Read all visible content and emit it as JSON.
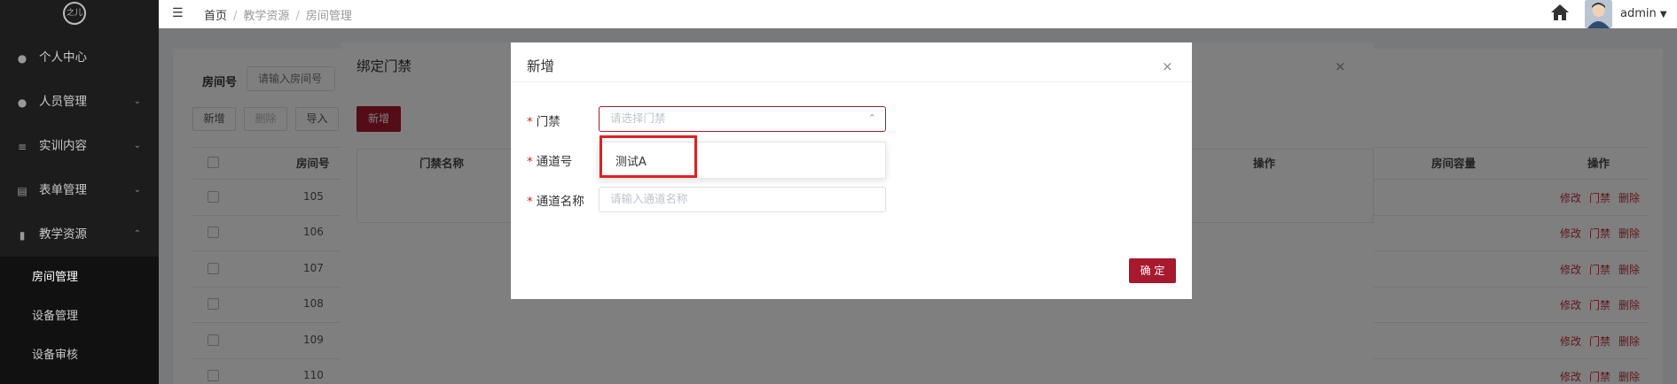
{
  "app": {
    "logo_text": "之儿"
  },
  "sidebar": {
    "items": [
      {
        "label": "个人中心",
        "icon": "user-icon"
      },
      {
        "label": "人员管理",
        "icon": "users-icon"
      },
      {
        "label": "实训内容",
        "icon": "list-icon"
      },
      {
        "label": "表单管理",
        "icon": "form-icon"
      },
      {
        "label": "教学资源",
        "icon": "book-icon"
      }
    ],
    "submenu": [
      {
        "label": "房间管理"
      },
      {
        "label": "设备管理"
      },
      {
        "label": "设备审核"
      }
    ]
  },
  "header": {
    "breadcrumb": [
      "首页",
      "教学资源",
      "房间管理"
    ],
    "username": "admin"
  },
  "page": {
    "search_label": "房间号",
    "search_placeholder": "请输入房间号",
    "buttons": {
      "add": "新增",
      "delete": "删除",
      "import": "导入"
    },
    "columns": {
      "room_no": "房间号",
      "capacity": "房间容量",
      "actions": "操作"
    },
    "rows": [
      "105",
      "106",
      "107",
      "108",
      "109",
      "110"
    ],
    "row_actions": {
      "edit": "修改",
      "access": "门禁",
      "delete": "删除"
    }
  },
  "bind_dialog": {
    "title": "绑定门禁",
    "add_button": "新增",
    "columns": {
      "name": "门禁名称",
      "actions": "操作"
    }
  },
  "add_dialog": {
    "title": "新增",
    "fields": {
      "door": {
        "label": "门禁",
        "placeholder": "请选择门禁"
      },
      "channel_no": {
        "label": "通道号"
      },
      "channel_name": {
        "label": "通道名称",
        "placeholder": "请输入通道名称"
      }
    },
    "dropdown_options": [
      "测试A"
    ],
    "confirm": "确 定"
  },
  "colors": {
    "accent": "#a8192e",
    "highlight_box": "#e02020"
  }
}
